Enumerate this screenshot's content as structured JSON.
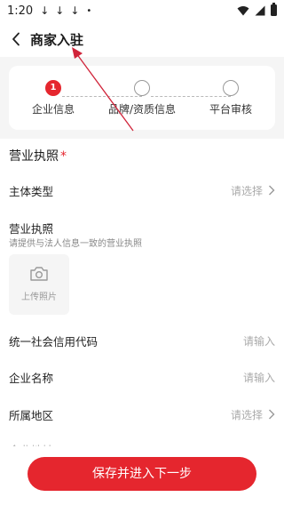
{
  "status_bar": {
    "time": "1:20",
    "download_glyph": "↓",
    "dot_glyph": "•",
    "icons": [
      "download-icon",
      "download-icon",
      "download-icon",
      "wifi-icon",
      "signal-icon",
      "battery-icon"
    ]
  },
  "nav": {
    "title": "商家入驻",
    "back_icon": "chevron-left-icon"
  },
  "steps": [
    {
      "number": "1",
      "label": "企业信息",
      "active": true
    },
    {
      "number": "",
      "label": "品牌/资质信息",
      "active": false
    },
    {
      "number": "",
      "label": "平台审核",
      "active": false
    }
  ],
  "form": {
    "section_title": "营业执照",
    "required_mark": "*",
    "entity_type": {
      "label": "主体类型",
      "placeholder": "请选择"
    },
    "license": {
      "label": "营业执照",
      "hint": "请提供与法人信息一致的营业执照",
      "upload_label": "上传照片",
      "upload_icon": "camera-icon"
    },
    "credit_code": {
      "label": "统一社会信用代码",
      "placeholder": "请输入"
    },
    "company_name": {
      "label": "企业名称",
      "placeholder": "请输入"
    },
    "region": {
      "label": "所属地区",
      "placeholder": "请选择"
    },
    "partial_row_label": "企业地址"
  },
  "submit_label": "保存并进入下一步",
  "colors": {
    "accent": "#e5262e",
    "background": "#f5f5f5",
    "annotation": "#d0243a"
  }
}
